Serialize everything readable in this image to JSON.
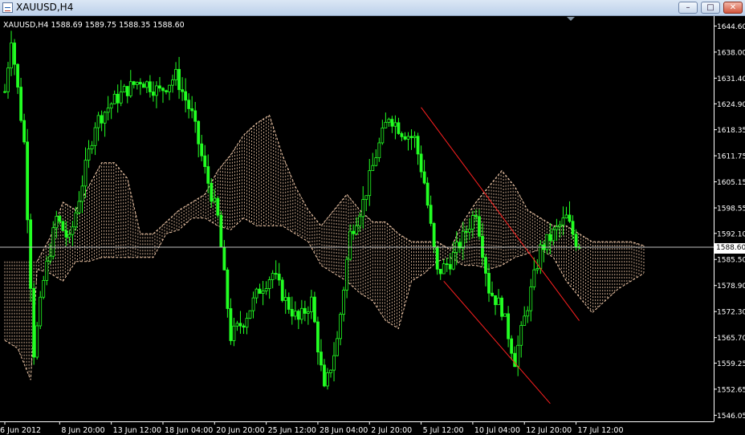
{
  "window": {
    "title": "XAUUSD,H4",
    "buttons": {
      "minimize": "–",
      "maximize": "□",
      "close": "✕"
    }
  },
  "colors": {
    "background": "#000000",
    "bull": "#22ff22",
    "cloud": "#f0c8a8",
    "trendline": "#ff2020",
    "axis": "#ffffff",
    "price_line": "#c0c0c0"
  },
  "chart_data": {
    "type": "candlestick",
    "symbol_info": "XAUUSD,H4  1588.69 1589.75 1588.35 1588.60",
    "current_price_label": "1588.60",
    "current_price": 1588.6,
    "ylim": [
      1544.5,
      1645.5
    ],
    "y_ticks": [
      {
        "value": 1644.6,
        "label": "1644.60"
      },
      {
        "value": 1638.0,
        "label": "1638.00"
      },
      {
        "value": 1631.4,
        "label": "1631.40"
      },
      {
        "value": 1624.9,
        "label": "1624.90"
      },
      {
        "value": 1618.35,
        "label": "1618.35"
      },
      {
        "value": 1611.75,
        "label": "1611.75"
      },
      {
        "value": 1605.15,
        "label": "1605.15"
      },
      {
        "value": 1598.55,
        "label": "1598.55"
      },
      {
        "value": 1592.1,
        "label": "1592.10"
      },
      {
        "value": 1585.5,
        "label": "1585.50"
      },
      {
        "value": 1578.9,
        "label": "1578.90"
      },
      {
        "value": 1572.3,
        "label": "1572.30"
      },
      {
        "value": 1565.7,
        "label": "1565.70"
      },
      {
        "value": 1559.25,
        "label": "1559.25"
      },
      {
        "value": 1552.65,
        "label": "1552.65"
      },
      {
        "value": 1546.05,
        "label": "1546.05"
      }
    ],
    "x_ticks": [
      {
        "bar": 0,
        "label": "6 Jun 2012"
      },
      {
        "bar": 17,
        "label": "8 Jun 20:00"
      },
      {
        "bar": 33,
        "label": "13 Jun 12:00"
      },
      {
        "bar": 49,
        "label": "18 Jun 04:00"
      },
      {
        "bar": 65,
        "label": "20 Jun 20:00"
      },
      {
        "bar": 81,
        "label": "25 Jun 12:00"
      },
      {
        "bar": 97,
        "label": "28 Jun 04:00"
      },
      {
        "bar": 113,
        "label": "2 Jul 20:00"
      },
      {
        "bar": 129,
        "label": "5 Jul 12:00"
      },
      {
        "bar": 145,
        "label": "10 Jul 04:00"
      },
      {
        "bar": 161,
        "label": "12 Jul 20:00"
      },
      {
        "bar": 177,
        "label": "17 Jul 12:00"
      }
    ],
    "bar_count": 205,
    "series_key_points": [
      [
        0,
        1628
      ],
      [
        2,
        1642
      ],
      [
        6,
        1615
      ],
      [
        9,
        1562
      ],
      [
        12,
        1580
      ],
      [
        16,
        1596
      ],
      [
        20,
        1590
      ],
      [
        24,
        1605
      ],
      [
        28,
        1620
      ],
      [
        33,
        1625
      ],
      [
        37,
        1628
      ],
      [
        42,
        1631
      ],
      [
        48,
        1628
      ],
      [
        53,
        1632
      ],
      [
        58,
        1622
      ],
      [
        62,
        1608
      ],
      [
        66,
        1596
      ],
      [
        70,
        1566
      ],
      [
        74,
        1570
      ],
      [
        79,
        1578
      ],
      [
        83,
        1582
      ],
      [
        87,
        1575
      ],
      [
        91,
        1570
      ],
      [
        95,
        1575
      ],
      [
        99,
        1552
      ],
      [
        103,
        1565
      ],
      [
        107,
        1592
      ],
      [
        111,
        1600
      ],
      [
        115,
        1612
      ],
      [
        119,
        1622
      ],
      [
        123,
        1618
      ],
      [
        127,
        1616
      ],
      [
        130,
        1605
      ],
      [
        134,
        1582
      ],
      [
        138,
        1585
      ],
      [
        142,
        1591
      ],
      [
        146,
        1598
      ],
      [
        150,
        1578
      ],
      [
        154,
        1573
      ],
      [
        158,
        1560
      ],
      [
        162,
        1574
      ],
      [
        166,
        1588
      ],
      [
        170,
        1592
      ],
      [
        174,
        1596
      ],
      [
        177,
        1590
      ],
      [
        178,
        1588.6
      ]
    ],
    "cloud_upper": [
      [
        10,
        1585
      ],
      [
        14,
        1591
      ],
      [
        18,
        1600
      ],
      [
        22,
        1598
      ],
      [
        26,
        1604
      ],
      [
        30,
        1610
      ],
      [
        34,
        1610
      ],
      [
        38,
        1606
      ],
      [
        42,
        1592
      ],
      [
        46,
        1592
      ],
      [
        50,
        1595
      ],
      [
        54,
        1598
      ],
      [
        58,
        1600
      ],
      [
        62,
        1602
      ],
      [
        66,
        1608
      ],
      [
        70,
        1612
      ],
      [
        74,
        1617
      ],
      [
        78,
        1620
      ],
      [
        82,
        1622
      ],
      [
        86,
        1612
      ],
      [
        90,
        1604
      ],
      [
        94,
        1598
      ],
      [
        98,
        1594
      ],
      [
        102,
        1598
      ],
      [
        106,
        1602
      ],
      [
        110,
        1598
      ],
      [
        114,
        1595
      ],
      [
        118,
        1595
      ],
      [
        122,
        1592
      ],
      [
        126,
        1590
      ],
      [
        130,
        1590
      ],
      [
        134,
        1590
      ],
      [
        138,
        1588
      ],
      [
        142,
        1595
      ],
      [
        146,
        1600
      ],
      [
        150,
        1604
      ],
      [
        154,
        1608
      ],
      [
        158,
        1604
      ],
      [
        162,
        1598
      ],
      [
        166,
        1596
      ],
      [
        170,
        1594
      ],
      [
        174,
        1594
      ],
      [
        178,
        1592
      ],
      [
        182,
        1590
      ],
      [
        186,
        1590
      ],
      [
        190,
        1590
      ],
      [
        194,
        1590
      ],
      [
        198,
        1589
      ]
    ],
    "cloud_lower": [
      [
        0,
        1565
      ],
      [
        4,
        1563
      ],
      [
        8,
        1555
      ],
      [
        10,
        1583
      ],
      [
        14,
        1582
      ],
      [
        18,
        1580
      ],
      [
        22,
        1585
      ],
      [
        26,
        1585
      ],
      [
        30,
        1586
      ],
      [
        34,
        1586
      ],
      [
        38,
        1586
      ],
      [
        42,
        1586
      ],
      [
        46,
        1586
      ],
      [
        50,
        1592
      ],
      [
        54,
        1593
      ],
      [
        58,
        1596
      ],
      [
        62,
        1596
      ],
      [
        66,
        1594
      ],
      [
        70,
        1593
      ],
      [
        74,
        1596
      ],
      [
        78,
        1594
      ],
      [
        82,
        1594
      ],
      [
        86,
        1594
      ],
      [
        90,
        1592
      ],
      [
        94,
        1590
      ],
      [
        98,
        1584
      ],
      [
        102,
        1582
      ],
      [
        106,
        1580
      ],
      [
        110,
        1577
      ],
      [
        114,
        1575
      ],
      [
        118,
        1570
      ],
      [
        122,
        1568
      ],
      [
        126,
        1580
      ],
      [
        130,
        1582
      ],
      [
        134,
        1585
      ],
      [
        138,
        1586
      ],
      [
        142,
        1584
      ],
      [
        146,
        1584
      ],
      [
        150,
        1583
      ],
      [
        154,
        1584
      ],
      [
        158,
        1586
      ],
      [
        162,
        1587
      ],
      [
        166,
        1588
      ],
      [
        170,
        1586
      ],
      [
        174,
        1580
      ],
      [
        178,
        1576
      ],
      [
        182,
        1572
      ],
      [
        186,
        1575
      ],
      [
        190,
        1578
      ],
      [
        194,
        1580
      ],
      [
        198,
        1582
      ]
    ],
    "trendlines": [
      {
        "from": [
          129,
          1624
        ],
        "to": [
          178,
          1570
        ]
      },
      {
        "from": [
          136,
          1580
        ],
        "to": [
          169,
          1549
        ]
      }
    ]
  }
}
